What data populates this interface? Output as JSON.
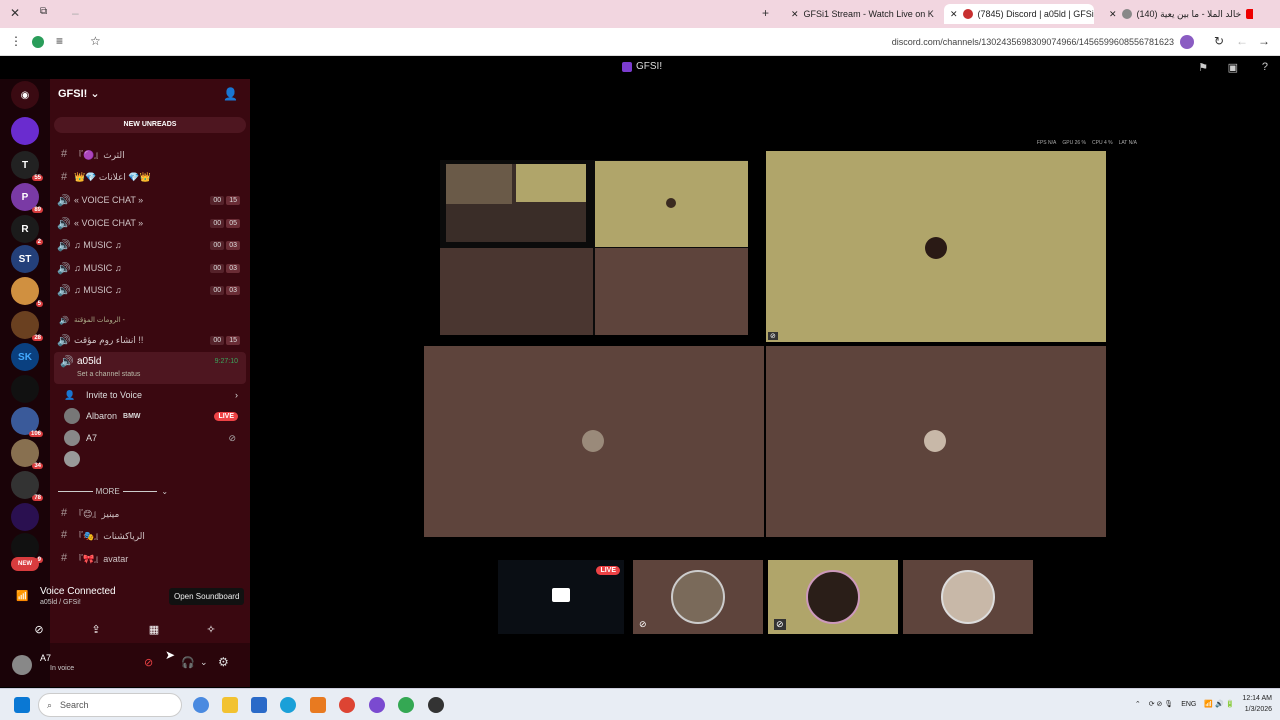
{
  "browser": {
    "tabs": [
      {
        "title": "GFSi1 Stream - Watch Live on K",
        "color": "#53fc18",
        "active": false
      },
      {
        "title": "(7845) Discord | a05ld | GFSi",
        "color": "#5865f2",
        "active": true
      },
      {
        "title": "(140) خالد الملا - ما بين يعية",
        "color": "#ff0000",
        "active": false
      }
    ],
    "url": "discord.com/channels/1302435698309074966/1456599608556781623"
  },
  "discord": {
    "server_name": "GFSI!",
    "title_server": "GFSI!",
    "new_unreads": "NEW UNREADS",
    "channels": [
      {
        "symbol": "#",
        "label": "『🟣』الثرث",
        "counts": null
      },
      {
        "symbol": "#",
        "label": "👑💎 اعلانات 💎👑",
        "counts": null
      },
      {
        "symbol": "🔊",
        "label": "« VOICE CHAT »",
        "counts": [
          "00",
          "15"
        ]
      },
      {
        "symbol": "🔊",
        "label": "« VOICE CHAT »",
        "counts": [
          "00",
          "05"
        ]
      },
      {
        "symbol": "🔊",
        "label": "♫ MUSIC ♫",
        "counts": [
          "00",
          "03"
        ]
      },
      {
        "symbol": "🔊",
        "label": "♫ MUSIC ♫",
        "counts": [
          "00",
          "03"
        ]
      },
      {
        "symbol": "🔊",
        "label": "♫ MUSIC ♫",
        "counts": [
          "00",
          "03"
        ]
      }
    ],
    "temp_category": "الرومات المؤقتة -",
    "temp_channel": {
      "label": "انشاء روم مؤقت !!",
      "counts": [
        "00",
        "15"
      ]
    },
    "active_voice": {
      "name": "a05ld",
      "timer": "9:27:10",
      "status": "Set a channel status"
    },
    "invite_label": "Invite to Voice",
    "voice_users": [
      {
        "name": "Albaron",
        "tag": "BMW",
        "live": "LIVE"
      },
      {
        "name": "A7"
      },
      {
        "name": ""
      }
    ],
    "more_label": "MORE",
    "more_channels": [
      {
        "label": "『😊』مينيز"
      },
      {
        "label": "『🎭』الرياكشنات"
      },
      {
        "label": "『🎀』avatar"
      }
    ],
    "voice_connected": "Voice Connected",
    "voice_location": "a05ld / GFSi!",
    "tooltip": "Open Soundboard",
    "user": {
      "name": "A7",
      "status": "In voice"
    },
    "stats": [
      "FPS N/A",
      "GPU 26 %",
      "CPU 4 %",
      "LAT N/A"
    ],
    "stream_live": "LIVE"
  },
  "taskbar": {
    "search_placeholder": "Search",
    "lang": "ENG",
    "time": "12:14 AM",
    "date": "1/3/2026"
  },
  "colors": {
    "sidebar": "#3a0810",
    "rail": "#1a0308",
    "tile_olive": "#b0a56a",
    "tile_brown": "#5e443c",
    "tile_dark": "#4a3630"
  }
}
